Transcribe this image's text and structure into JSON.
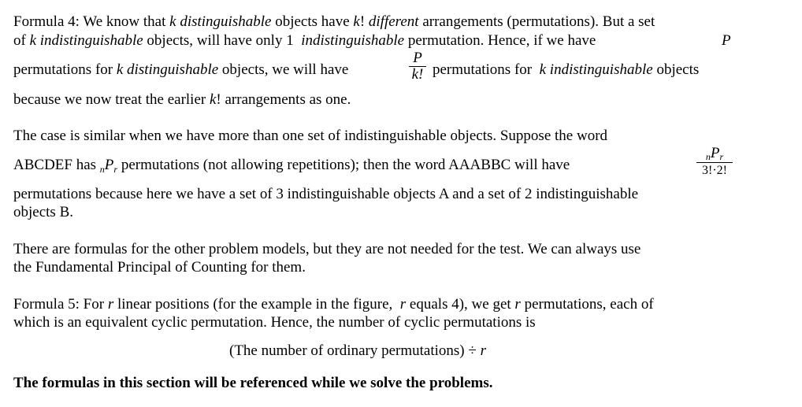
{
  "formula4": {
    "label": "Formula 4: We know that",
    "k1": "k",
    "distinguishable1": "distinguishable",
    "objects_have": "objects have",
    "kfact1": "k",
    "excl1": "!",
    "different": "different",
    "arrangements": "arrangements (permutations). But a set",
    "of": "of",
    "k2": "k",
    "indistinguishable1": "indistinguishable",
    "objects_will_have_only_1": "objects, will have only 1",
    "indistinguishable2": "indistinguishable",
    "permutation_hence": "permutation. Hence, if we have",
    "P": "P",
    "permutations_for": "permutations for",
    "k3": "k",
    "distinguishable2": "distinguishable",
    "objects_we_will_have": "objects, we will have",
    "frac_num": "P",
    "frac_den": "k!",
    "permutations_for2": "permutations for",
    "k4": "k",
    "indistinguishable3": "indistinguishable",
    "objects": "objects",
    "because": "because we now treat the earlier",
    "kfact2": "k",
    "arrangements_as_one": "! arrangements as one."
  },
  "case": {
    "line1": "The case is similar when we have more than one set of indistinguishable objects. Suppose the word",
    "abcdef": "ABCDEF has",
    "n": "n",
    "P": "P",
    "r": "r",
    "rest": "permutations (not allowing repetitions); then the word AAABBC will have",
    "frac_n": "n",
    "frac_P": "P",
    "frac_r": "r",
    "frac_den": "3!·2!",
    "line3": "permutations because here we have a set of 3 indistinguishable objects A and a set of 2 indistinguishable",
    "line4": "objects B."
  },
  "other": {
    "line1": "There are formulas for the other problem models, but they are not needed for the test. We can always use",
    "line2": "the Fundamental Principal of Counting for them."
  },
  "formula5": {
    "label": "Formula 5: For",
    "r1": "r",
    "mid": "linear positions (for the example in the figure,",
    "r2": "r",
    "equals": "equals 4), we get",
    "r3": "r",
    "tail": "permutations, each of",
    "line2": "which is an equivalent cyclic permutation. Hence, the number of cyclic permutations is",
    "centered": "(The number of ordinary permutations) ÷",
    "r4": "r"
  },
  "footer": {
    "bold": "The formulas in this section will be referenced while we solve the problems."
  }
}
